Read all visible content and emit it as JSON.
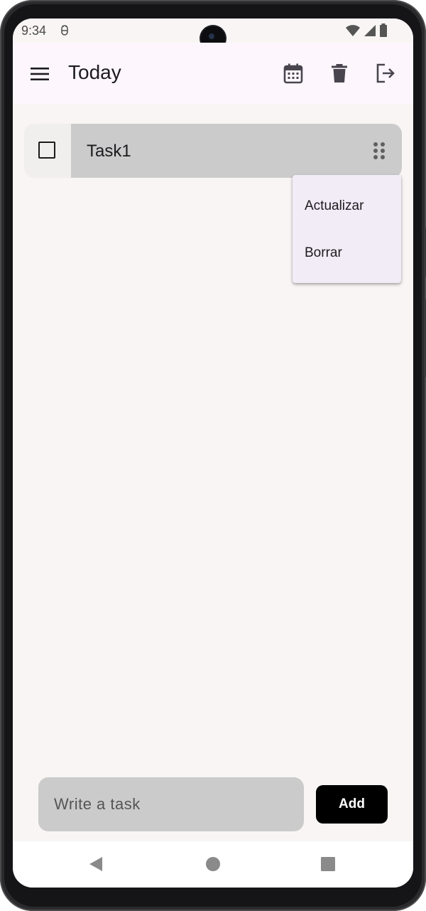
{
  "status_bar": {
    "time": "9:34",
    "icons": [
      "debug-icon",
      "wifi-icon",
      "signal-icon",
      "battery-icon"
    ]
  },
  "app_bar": {
    "title": "Today",
    "background": "#fdf6fd",
    "actions": [
      "calendar-icon",
      "delete-icon",
      "logout-icon"
    ]
  },
  "tasks": [
    {
      "title": "Task1",
      "checked": false
    }
  ],
  "context_menu": {
    "items": [
      "Actualizar",
      "Borrar"
    ]
  },
  "composer": {
    "placeholder": "Write a task",
    "value": "",
    "add_label": "Add"
  },
  "colors": {
    "screen_background": "#f8f5f4",
    "task_body": "#cbcbcb",
    "menu_background": "#f1ecf6",
    "add_button": "#000000"
  }
}
